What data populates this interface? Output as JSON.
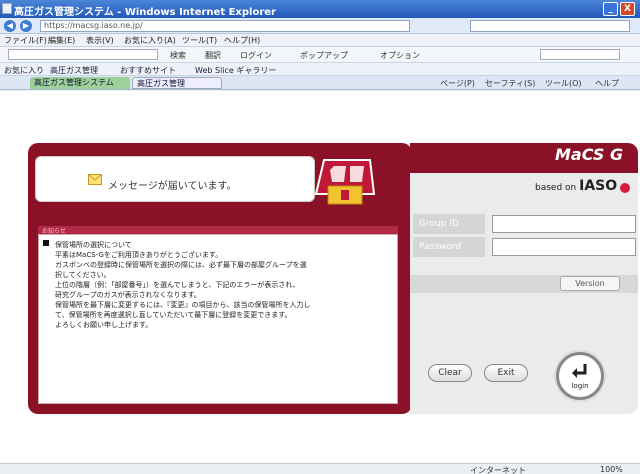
{
  "window": {
    "title": "高圧ガス管理システム - Windows Internet Explorer",
    "min_glyph": "_",
    "close_glyph": "X"
  },
  "addressbar": {
    "back_glyph": "◀",
    "forward_glyph": "▶",
    "url": "https://macsg.iaso.ne.jp/",
    "search_placeholder": ""
  },
  "menubar": {
    "items": [
      "ファイル(F)",
      "編集(E)",
      "表示(V)",
      "お気に入り(A)",
      "ツール(T)",
      "ヘルプ(H)"
    ]
  },
  "toolbar": {
    "items": [
      "検索",
      "翻訳",
      "ログイン",
      "ポップアップ",
      "オプション"
    ]
  },
  "favorites": {
    "items": [
      "お気に入り",
      "高圧ガス管理",
      "おすすめサイト",
      "Web Slice ギャラリー"
    ]
  },
  "tabs": {
    "active_label": "高圧ガス管理システム",
    "other_label": "高圧ガス管理",
    "commands": [
      "ページ(P)",
      "セーフティ(S)",
      "ツール(O)",
      "ヘルプ"
    ]
  },
  "login_card": {
    "message": "メッセージが届いています。",
    "notice_header": "お知らせ",
    "notice_lines": [
      "保管場所の選択について",
      "平素はMaCS-Gをご利用頂きありがとうございます。",
      "ガスボンベの登録時に保管場所を選択の際には、必ず最下層の部屋グループを選",
      "択してください。",
      "上位の階層（例：「部屋番号」）を選んでしまうと、下記のエラーが表示され、",
      "研究グループのガスが表示されなくなります。",
      "保管場所を最下層に変更するには、『変更』の項目から、該当の保管場所を入力し",
      "て、保管場所を再度選択し直していただいて最下層に登録を変更できます。",
      "よろしくお願い申し上げます。"
    ],
    "brand": "MaCS G",
    "based_on": "based on",
    "iaso_brand": "IASO",
    "group_id_label": "Group ID",
    "group_id_value": "",
    "password_label": "Password",
    "password_value": "",
    "version_button": "Version",
    "clear_button": "Clear",
    "exit_button": "Exit",
    "login_button": "login"
  },
  "statusbar": {
    "zone": "インターネット",
    "zoom": "100%"
  }
}
